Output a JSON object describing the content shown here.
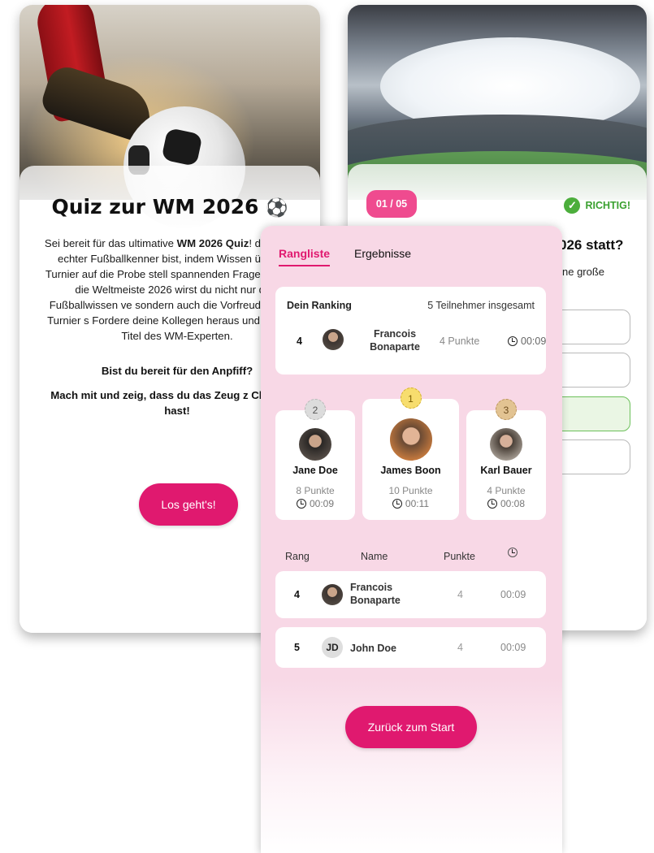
{
  "intro": {
    "title": "Quiz zur WM 2026",
    "title_icon": "⚽",
    "text_prefix": "Sei bereit für das ultimative ",
    "text_bold": "WM 2026 Quiz",
    "text_rest": "! dass du ein echter Fußballkenner bist, indem Wissen über das Turnier auf die Probe stell spannenden Fragen rund um die Weltmeiste 2026 wirst du nicht nur dein Fußballwissen ve sondern auch die Vorfreude auf das Turnier s Fordere deine Kollegen heraus und kämpfe u Titel des WM-Experten.",
    "question_1": "Bist du bereit für den Anpfiff?",
    "question_2": "Mach mit und zeig, dass du das Zeug z Champion hast!",
    "start_button": "Los geht's!"
  },
  "question_card": {
    "counter": "01 / 05",
    "status": "RICHTIG!",
    "status_color": "#3aa02f",
    "title_fragment": "026 statt?",
    "subtitle_fragment": "ne große",
    "answers_count": 4,
    "correct_index": 2
  },
  "ranking": {
    "tabs": [
      {
        "label": "Rangliste",
        "active": true
      },
      {
        "label": "Ergebnisse",
        "active": false
      }
    ],
    "my_ranking": {
      "label": "Dein Ranking",
      "participants": "5 Teilnehmer insgesamt",
      "rank": "4",
      "name": "Francois Bonaparte",
      "points": "4 Punkte",
      "time": "00:09"
    },
    "podium": [
      {
        "place": "2",
        "name": "Jane Doe",
        "points": "8 Punkte",
        "time": "00:09"
      },
      {
        "place": "1",
        "name": "James Boon",
        "points": "10 Punkte",
        "time": "00:11"
      },
      {
        "place": "3",
        "name": "Karl Bauer",
        "points": "4 Punkte",
        "time": "00:08"
      }
    ],
    "table_headers": {
      "rank": "Rang",
      "name": "Name",
      "points": "Punkte",
      "time_icon": "clock-icon"
    },
    "rows": [
      {
        "rank": "4",
        "avatar": "photo",
        "name": "Francois Bonaparte",
        "points": "4",
        "time": "00:09"
      },
      {
        "rank": "5",
        "avatar": "JD",
        "name": "John Doe",
        "points": "4",
        "time": "00:09"
      }
    ],
    "back_button": "Zurück zum Start"
  },
  "colors": {
    "accent": "#e0196f",
    "counter_bg": "#ef4b8f",
    "ranking_bg": "#f8d8e6",
    "correct": "#4cae3c"
  }
}
